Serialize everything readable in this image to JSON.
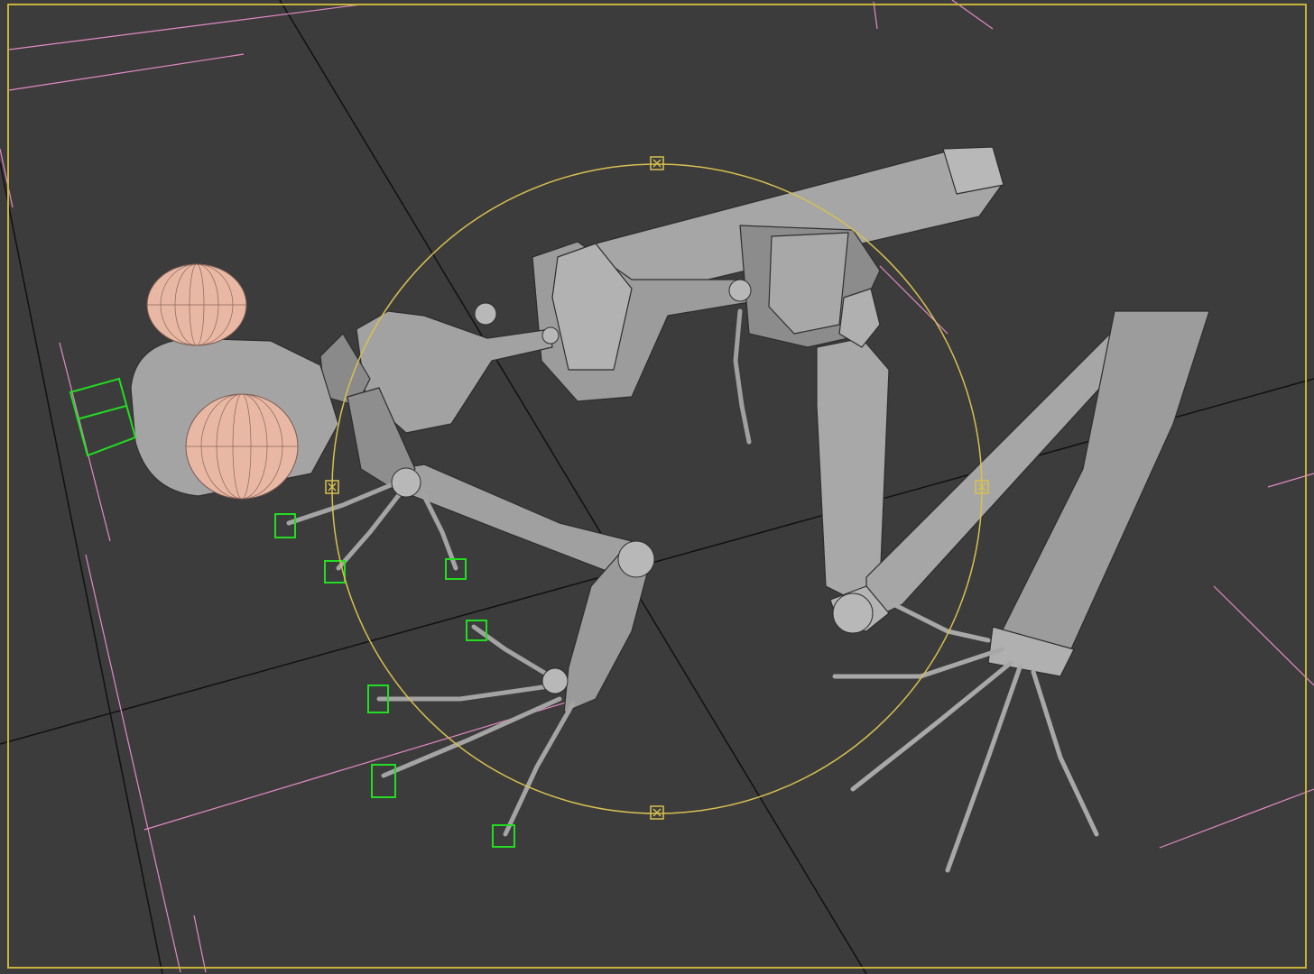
{
  "viewport": {
    "name": "perspective-viewport",
    "active_border_color": "#c8b43a",
    "background_color": "#3c3c3c"
  },
  "colors": {
    "grid_line": "#111111",
    "bone": "#9a9a9a",
    "bone_dark": "#6e6e6e",
    "bone_light": "#c8c8c8",
    "edge": "#2e2e2e",
    "eye": "#e8b8a4",
    "ik_control": "#22dd22",
    "selection_circle": "#d8c050",
    "pink_guide": "#e28ac4"
  },
  "icons": {
    "gizmo_handle": "x-square-handle"
  }
}
